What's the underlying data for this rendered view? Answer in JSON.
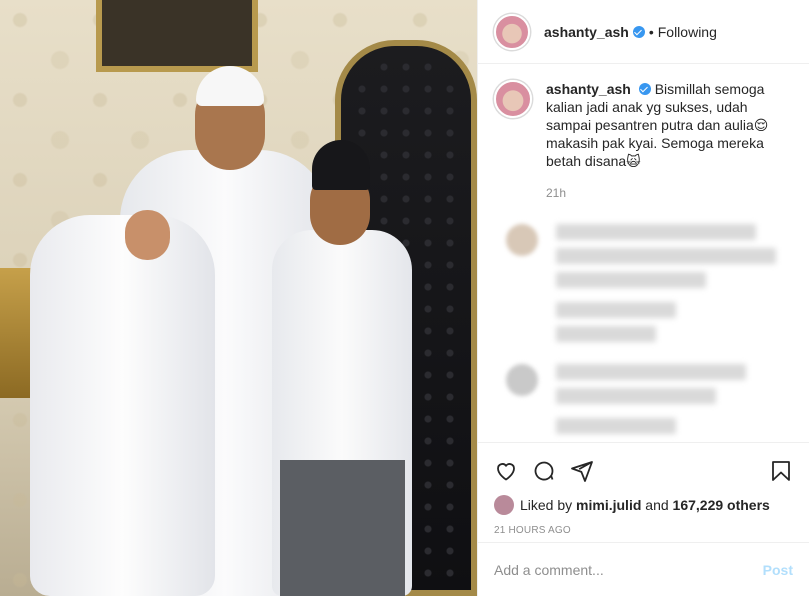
{
  "post": {
    "author": "ashanty_ash",
    "follow_status": "Following",
    "caption": "Bismillah semoga kalian jadi anak yg sukses, udah sampai pesantren putra dan aulia😌 makasih pak kyai. Semoga mereka betah disana🙀",
    "caption_age": "21h",
    "liked_by": "mimi.julid",
    "likes_others": "167,229 others",
    "liked_by_prefix": "Liked by",
    "liked_and": "and",
    "timestamp": "21 HOURS AGO"
  },
  "comment_box": {
    "placeholder": "Add a comment...",
    "post_label": "Post"
  },
  "header": {
    "dot": "•"
  },
  "icons": [
    "heart-icon",
    "comment-icon",
    "share-icon",
    "bookmark-icon",
    "verified-icon"
  ],
  "colors": {
    "verified": "#3897f0",
    "post_disabled": "#b2dffc",
    "muted": "#8e8e8e",
    "text": "#262626"
  }
}
